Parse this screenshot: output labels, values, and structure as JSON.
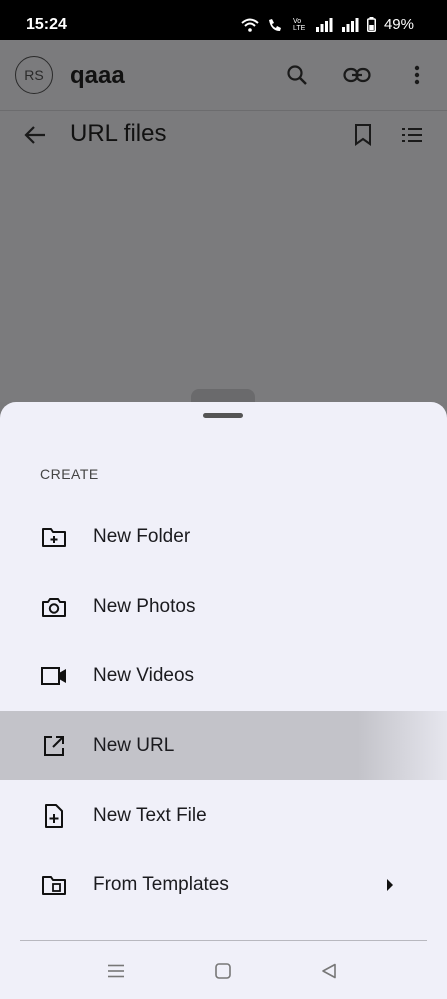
{
  "status_bar": {
    "time": "15:24",
    "battery": "49%",
    "volte_label": "Vo LTE"
  },
  "header": {
    "avatar_initials": "RS",
    "workspace_title": "qaaa"
  },
  "sub_header": {
    "title": "URL files"
  },
  "sheet": {
    "section_title": "CREATE",
    "items": [
      {
        "label": "New Folder",
        "icon": "create-folder-icon"
      },
      {
        "label": "New Photos",
        "icon": "camera-icon"
      },
      {
        "label": "New Videos",
        "icon": "video-camera-icon"
      },
      {
        "label": "New URL",
        "icon": "open-in-new-icon",
        "highlighted": true
      },
      {
        "label": "New Text File",
        "icon": "note-add-icon"
      },
      {
        "label": "From Templates",
        "icon": "template-folder-icon",
        "has_submenu": true
      }
    ]
  },
  "colors": {
    "scrim": "#7a7a7c",
    "sheet_bg": "#f0f0f9",
    "highlight": "#c3c3c9",
    "text": "#1b1b1f"
  }
}
